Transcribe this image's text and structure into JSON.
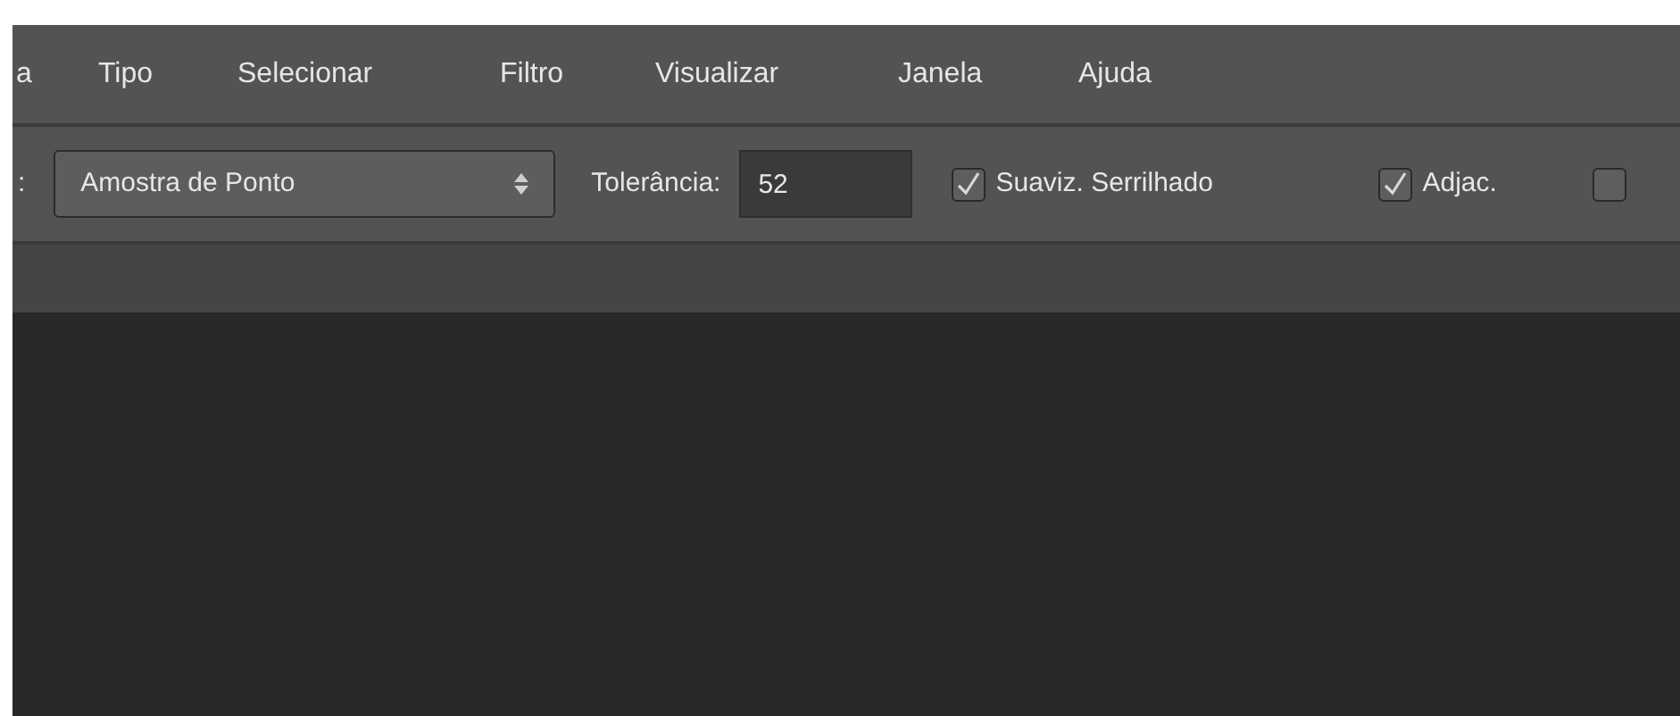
{
  "menu": [
    {
      "label": "a"
    },
    {
      "label": "Tipo"
    },
    {
      "label": "Selecionar"
    },
    {
      "label": "Filtro"
    },
    {
      "label": "Visualizar"
    },
    {
      "label": "Janela"
    },
    {
      "label": "Ajuda"
    }
  ],
  "options": {
    "prefix": ":",
    "sample": {
      "value": "Amostra de Ponto"
    },
    "tolerance": {
      "label": "Tolerância:",
      "value": "52"
    },
    "checks": [
      {
        "label": "Suaviz. Serrilhado",
        "checked": true
      },
      {
        "label": "Adjac.",
        "checked": true
      },
      {
        "checked": false
      }
    ]
  }
}
